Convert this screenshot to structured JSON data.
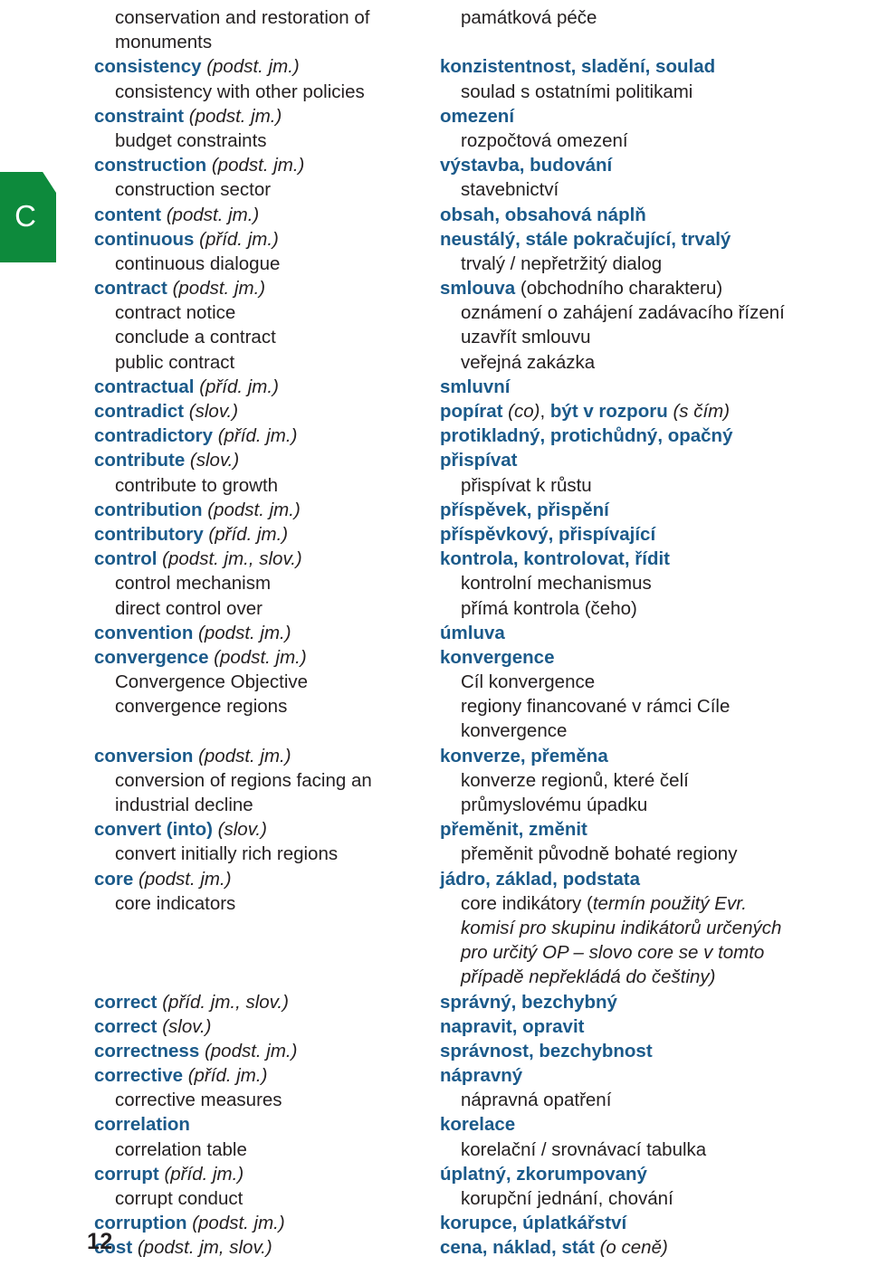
{
  "page": {
    "number": "12",
    "thumb_tab_letter": "C",
    "colors": {
      "headword_blue": "#1b5a8a",
      "tab_green": "#0d8a3c",
      "body_text": "#231f20"
    }
  },
  "rows": [
    {
      "en": [
        {
          "t": "conservation and restoration of",
          "s": "plain"
        }
      ],
      "en_indent": true,
      "cs": [
        {
          "t": "památková péče",
          "s": "plain"
        }
      ],
      "cs_indent": true
    },
    {
      "en": [
        {
          "t": "monuments",
          "s": "plain"
        }
      ],
      "en_indent": true,
      "cs": [],
      "cs_indent": true
    },
    {
      "en": [
        {
          "t": "consistency ",
          "s": "hw"
        },
        {
          "t": "(podst. jm.)",
          "s": "pos"
        }
      ],
      "en_indent": false,
      "cs": [
        {
          "t": "konzistentnost, sladění, soulad",
          "s": "hw"
        }
      ],
      "cs_indent": false
    },
    {
      "en": [
        {
          "t": "consistency with other policies",
          "s": "plain"
        }
      ],
      "en_indent": true,
      "cs": [
        {
          "t": "soulad s ostatními politikami",
          "s": "plain"
        }
      ],
      "cs_indent": true
    },
    {
      "en": [
        {
          "t": "constraint ",
          "s": "hw"
        },
        {
          "t": "(podst. jm.)",
          "s": "pos"
        }
      ],
      "en_indent": false,
      "cs": [
        {
          "t": "omezení",
          "s": "hw"
        }
      ],
      "cs_indent": false
    },
    {
      "en": [
        {
          "t": "budget constraints",
          "s": "plain"
        }
      ],
      "en_indent": true,
      "cs": [
        {
          "t": "rozpočtová omezení",
          "s": "plain"
        }
      ],
      "cs_indent": true
    },
    {
      "en": [
        {
          "t": "construction ",
          "s": "hw"
        },
        {
          "t": "(podst. jm.)",
          "s": "pos"
        }
      ],
      "en_indent": false,
      "cs": [
        {
          "t": "výstavba, budování",
          "s": "hw"
        }
      ],
      "cs_indent": false
    },
    {
      "en": [
        {
          "t": "construction sector",
          "s": "plain"
        }
      ],
      "en_indent": true,
      "cs": [
        {
          "t": "stavebnictví",
          "s": "plain"
        }
      ],
      "cs_indent": true
    },
    {
      "en": [
        {
          "t": "content ",
          "s": "hw"
        },
        {
          "t": "(podst. jm.)",
          "s": "pos"
        }
      ],
      "en_indent": false,
      "cs": [
        {
          "t": "obsah, obsahová náplň",
          "s": "hw"
        }
      ],
      "cs_indent": false
    },
    {
      "en": [
        {
          "t": "continuous ",
          "s": "hw"
        },
        {
          "t": "(příd. jm.)",
          "s": "pos"
        }
      ],
      "en_indent": false,
      "cs": [
        {
          "t": "neustálý, stále pokračující, trvalý",
          "s": "hw"
        }
      ],
      "cs_indent": false
    },
    {
      "en": [
        {
          "t": "continuous dialogue",
          "s": "plain"
        }
      ],
      "en_indent": true,
      "cs": [
        {
          "t": "trvalý / nepřetržitý dialog",
          "s": "plain"
        }
      ],
      "cs_indent": true
    },
    {
      "en": [
        {
          "t": "contract ",
          "s": "hw"
        },
        {
          "t": "(podst. jm.)",
          "s": "pos"
        }
      ],
      "en_indent": false,
      "cs": [
        {
          "t": "smlouva ",
          "s": "hw"
        },
        {
          "t": "(obchodního charakteru)",
          "s": "plain"
        }
      ],
      "cs_indent": false
    },
    {
      "en": [
        {
          "t": "contract notice",
          "s": "plain"
        }
      ],
      "en_indent": true,
      "cs": [
        {
          "t": "oznámení o zahájení zadávacího řízení",
          "s": "plain"
        }
      ],
      "cs_indent": true
    },
    {
      "en": [
        {
          "t": "conclude a contract",
          "s": "plain"
        }
      ],
      "en_indent": true,
      "cs": [
        {
          "t": "uzavřít smlouvu",
          "s": "plain"
        }
      ],
      "cs_indent": true
    },
    {
      "en": [
        {
          "t": "public contract",
          "s": "plain"
        }
      ],
      "en_indent": true,
      "cs": [
        {
          "t": "veřejná zakázka",
          "s": "plain"
        }
      ],
      "cs_indent": true
    },
    {
      "en": [
        {
          "t": "contractual ",
          "s": "hw"
        },
        {
          "t": "(příd. jm.)",
          "s": "pos"
        }
      ],
      "en_indent": false,
      "cs": [
        {
          "t": "smluvní",
          "s": "hw"
        }
      ],
      "cs_indent": false
    },
    {
      "en": [
        {
          "t": "contradict ",
          "s": "hw"
        },
        {
          "t": "(slov.)",
          "s": "pos"
        }
      ],
      "en_indent": false,
      "cs": [
        {
          "t": "popírat ",
          "s": "hw"
        },
        {
          "t": "(co)",
          "s": "it"
        },
        {
          "t": ", ",
          "s": "plain"
        },
        {
          "t": "být v rozporu ",
          "s": "hw"
        },
        {
          "t": "(s čím)",
          "s": "it"
        }
      ],
      "cs_indent": false
    },
    {
      "en": [
        {
          "t": "contradictory ",
          "s": "hw"
        },
        {
          "t": "(příd. jm.)",
          "s": "pos"
        }
      ],
      "en_indent": false,
      "cs": [
        {
          "t": "protikladný, protichůdný, opačný",
          "s": "hw"
        }
      ],
      "cs_indent": false
    },
    {
      "en": [
        {
          "t": "contribute ",
          "s": "hw"
        },
        {
          "t": "(slov.)",
          "s": "pos"
        }
      ],
      "en_indent": false,
      "cs": [
        {
          "t": "přispívat",
          "s": "hw"
        }
      ],
      "cs_indent": false
    },
    {
      "en": [
        {
          "t": "contribute to growth",
          "s": "plain"
        }
      ],
      "en_indent": true,
      "cs": [
        {
          "t": "přispívat k růstu",
          "s": "plain"
        }
      ],
      "cs_indent": true
    },
    {
      "en": [
        {
          "t": "contribution ",
          "s": "hw"
        },
        {
          "t": "(podst. jm.)",
          "s": "pos"
        }
      ],
      "en_indent": false,
      "cs": [
        {
          "t": "příspěvek, přispění",
          "s": "hw"
        }
      ],
      "cs_indent": false
    },
    {
      "en": [
        {
          "t": "contributory ",
          "s": "hw"
        },
        {
          "t": "(příd. jm.)",
          "s": "pos"
        }
      ],
      "en_indent": false,
      "cs": [
        {
          "t": "příspěvkový, přispívající",
          "s": "hw"
        }
      ],
      "cs_indent": false
    },
    {
      "en": [
        {
          "t": "control ",
          "s": "hw"
        },
        {
          "t": "(podst. jm., slov.)",
          "s": "pos"
        }
      ],
      "en_indent": false,
      "cs": [
        {
          "t": "kontrola, kontrolovat, řídit",
          "s": "hw"
        }
      ],
      "cs_indent": false
    },
    {
      "en": [
        {
          "t": "control mechanism",
          "s": "plain"
        }
      ],
      "en_indent": true,
      "cs": [
        {
          "t": "kontrolní mechanismus",
          "s": "plain"
        }
      ],
      "cs_indent": true
    },
    {
      "en": [
        {
          "t": "direct control over",
          "s": "plain"
        }
      ],
      "en_indent": true,
      "cs": [
        {
          "t": "přímá kontrola (čeho)",
          "s": "plain"
        }
      ],
      "cs_indent": true
    },
    {
      "en": [
        {
          "t": "convention ",
          "s": "hw"
        },
        {
          "t": "(podst. jm.)",
          "s": "pos"
        }
      ],
      "en_indent": false,
      "cs": [
        {
          "t": "úmluva",
          "s": "hw"
        }
      ],
      "cs_indent": false
    },
    {
      "en": [
        {
          "t": "convergence ",
          "s": "hw"
        },
        {
          "t": "(podst. jm.)",
          "s": "pos"
        }
      ],
      "en_indent": false,
      "cs": [
        {
          "t": "konvergence",
          "s": "hw"
        }
      ],
      "cs_indent": false
    },
    {
      "en": [
        {
          "t": "Convergence Objective",
          "s": "plain"
        }
      ],
      "en_indent": true,
      "cs": [
        {
          "t": "Cíl konvergence",
          "s": "plain"
        }
      ],
      "cs_indent": true
    },
    {
      "en": [
        {
          "t": "convergence regions",
          "s": "plain"
        }
      ],
      "en_indent": true,
      "cs": [
        {
          "t": "regiony financované v rámci Cíle",
          "s": "plain"
        }
      ],
      "cs_indent": true
    },
    {
      "en": [],
      "en_indent": true,
      "cs": [
        {
          "t": "konvergence",
          "s": "plain"
        }
      ],
      "cs_indent": true
    },
    {
      "en": [
        {
          "t": "conversion ",
          "s": "hw"
        },
        {
          "t": "(podst. jm.)",
          "s": "pos"
        }
      ],
      "en_indent": false,
      "cs": [
        {
          "t": "konverze, přeměna",
          "s": "hw"
        }
      ],
      "cs_indent": false
    },
    {
      "en": [
        {
          "t": "conversion of regions facing an",
          "s": "plain"
        }
      ],
      "en_indent": true,
      "cs": [
        {
          "t": "konverze regionů, které čelí",
          "s": "plain"
        }
      ],
      "cs_indent": true
    },
    {
      "en": [
        {
          "t": "industrial decline",
          "s": "plain"
        }
      ],
      "en_indent": true,
      "cs": [
        {
          "t": "průmyslovému úpadku",
          "s": "plain"
        }
      ],
      "cs_indent": true
    },
    {
      "en": [
        {
          "t": "convert (into) ",
          "s": "hw"
        },
        {
          "t": "(slov.)",
          "s": "pos"
        }
      ],
      "en_indent": false,
      "cs": [
        {
          "t": "přeměnit, změnit",
          "s": "hw"
        }
      ],
      "cs_indent": false
    },
    {
      "en": [
        {
          "t": "convert initially rich regions",
          "s": "plain"
        }
      ],
      "en_indent": true,
      "cs": [
        {
          "t": "přeměnit původně bohaté regiony",
          "s": "plain"
        }
      ],
      "cs_indent": true
    },
    {
      "en": [
        {
          "t": "core ",
          "s": "hw"
        },
        {
          "t": "(podst. jm.)",
          "s": "pos"
        }
      ],
      "en_indent": false,
      "cs": [
        {
          "t": "jádro, základ, podstata",
          "s": "hw"
        }
      ],
      "cs_indent": false
    },
    {
      "en": [
        {
          "t": "core indicators",
          "s": "plain"
        }
      ],
      "en_indent": true,
      "cs": [
        {
          "t": "core indikátory (",
          "s": "plain"
        },
        {
          "t": "termín použitý Evr.",
          "s": "it"
        }
      ],
      "cs_indent": true
    },
    {
      "en": [],
      "en_indent": true,
      "cs": [
        {
          "t": "komisí pro skupinu indikátorů určených",
          "s": "it"
        }
      ],
      "cs_indent": true
    },
    {
      "en": [],
      "en_indent": true,
      "cs": [
        {
          "t": "pro určitý OP – slovo core se v tomto",
          "s": "it"
        }
      ],
      "cs_indent": true
    },
    {
      "en": [],
      "en_indent": true,
      "cs": [
        {
          "t": "případě nepřekládá do češtiny)",
          "s": "it"
        }
      ],
      "cs_indent": true
    },
    {
      "en": [
        {
          "t": "correct ",
          "s": "hw"
        },
        {
          "t": "(příd. jm., slov.)",
          "s": "pos"
        }
      ],
      "en_indent": false,
      "cs": [
        {
          "t": "správný, bezchybný",
          "s": "hw"
        }
      ],
      "cs_indent": false
    },
    {
      "en": [
        {
          "t": "correct ",
          "s": "hw"
        },
        {
          "t": "(slov.)",
          "s": "pos"
        }
      ],
      "en_indent": false,
      "cs": [
        {
          "t": "napravit, opravit",
          "s": "hw"
        }
      ],
      "cs_indent": false
    },
    {
      "en": [
        {
          "t": "correctness ",
          "s": "hw"
        },
        {
          "t": "(podst. jm.)",
          "s": "pos"
        }
      ],
      "en_indent": false,
      "cs": [
        {
          "t": "správnost, bezchybnost",
          "s": "hw"
        }
      ],
      "cs_indent": false
    },
    {
      "en": [
        {
          "t": "corrective ",
          "s": "hw"
        },
        {
          "t": "(příd. jm.)",
          "s": "pos"
        }
      ],
      "en_indent": false,
      "cs": [
        {
          "t": "nápravný",
          "s": "hw"
        }
      ],
      "cs_indent": false
    },
    {
      "en": [
        {
          "t": "corrective measures",
          "s": "plain"
        }
      ],
      "en_indent": true,
      "cs": [
        {
          "t": "nápravná opatření",
          "s": "plain"
        }
      ],
      "cs_indent": true
    },
    {
      "en": [
        {
          "t": "correlation",
          "s": "hw"
        }
      ],
      "en_indent": false,
      "cs": [
        {
          "t": "korelace",
          "s": "hw"
        }
      ],
      "cs_indent": false
    },
    {
      "en": [
        {
          "t": "correlation table",
          "s": "plain"
        }
      ],
      "en_indent": true,
      "cs": [
        {
          "t": "korelační / srovnávací tabulka",
          "s": "plain"
        }
      ],
      "cs_indent": true
    },
    {
      "en": [
        {
          "t": "corrupt ",
          "s": "hw"
        },
        {
          "t": "(příd. jm.)",
          "s": "pos"
        }
      ],
      "en_indent": false,
      "cs": [
        {
          "t": "úplatný, zkorumpovaný",
          "s": "hw"
        }
      ],
      "cs_indent": false
    },
    {
      "en": [
        {
          "t": "corrupt conduct",
          "s": "plain"
        }
      ],
      "en_indent": true,
      "cs": [
        {
          "t": "korupční jednání, chování",
          "s": "plain"
        }
      ],
      "cs_indent": true
    },
    {
      "en": [
        {
          "t": "corruption ",
          "s": "hw"
        },
        {
          "t": "(podst. jm.)",
          "s": "pos"
        }
      ],
      "en_indent": false,
      "cs": [
        {
          "t": "korupce, úplatkářství",
          "s": "hw"
        }
      ],
      "cs_indent": false
    },
    {
      "en": [
        {
          "t": "cost ",
          "s": "hw"
        },
        {
          "t": "(podst. jm, slov.)",
          "s": "pos"
        }
      ],
      "en_indent": false,
      "cs": [
        {
          "t": "cena, náklad, stát ",
          "s": "hw"
        },
        {
          "t": "(o ceně)",
          "s": "it"
        }
      ],
      "cs_indent": false
    }
  ]
}
